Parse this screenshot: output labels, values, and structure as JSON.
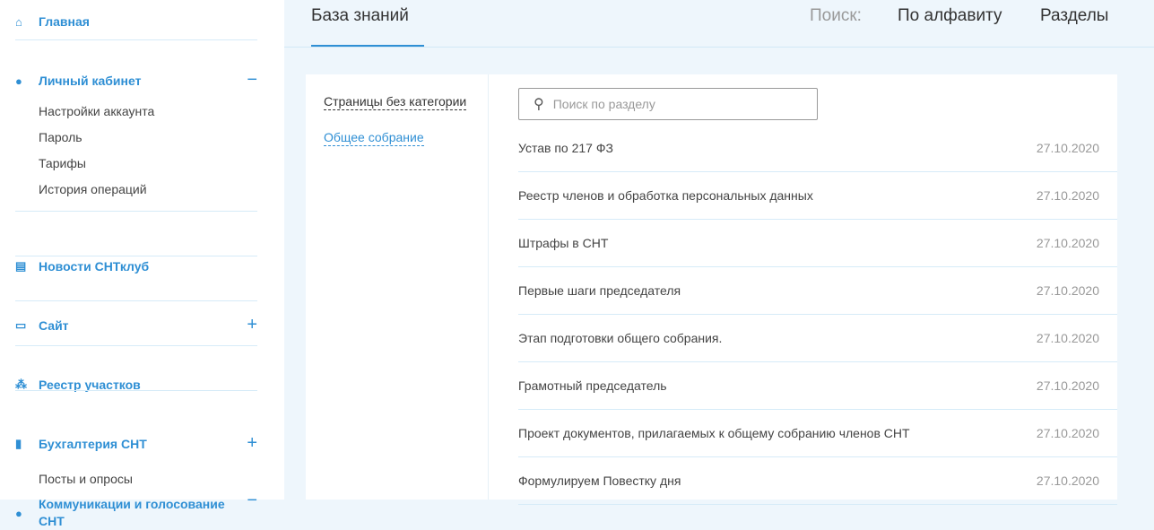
{
  "sidebar": {
    "home": "Главная",
    "account": "Личный кабинет",
    "account_items": [
      "Настройки аккаунта",
      "Пароль",
      "Тарифы",
      "История операций"
    ],
    "news": "Новости СНТклуб",
    "site": "Сайт",
    "registry": "Реестр участков",
    "accounting": "Бухгалтерия СНТ",
    "comm": "Коммуникации и голосование СНТ",
    "comm_items": [
      "Посты и опросы"
    ],
    "expand": "+",
    "collapse": "−"
  },
  "header": {
    "title": "База знаний",
    "search_label": "Поиск:",
    "alphabet": "По алфавиту",
    "sections": "Разделы"
  },
  "categories": [
    "Страницы без категории",
    "Общее собрание"
  ],
  "search": {
    "placeholder": "Поиск по разделу"
  },
  "articles": [
    {
      "title": "Устав по 217 ФЗ",
      "date": "27.10.2020"
    },
    {
      "title": "Реестр членов и обработка персональных данных",
      "date": "27.10.2020"
    },
    {
      "title": "Штрафы в СНТ",
      "date": "27.10.2020"
    },
    {
      "title": "Первые шаги председателя",
      "date": "27.10.2020"
    },
    {
      "title": "Этап подготовки общего собрания.",
      "date": "27.10.2020"
    },
    {
      "title": "Грамотный председатель",
      "date": "27.10.2020"
    },
    {
      "title": "Проект документов, прилагаемых к общему собранию членов СНТ",
      "date": "27.10.2020"
    },
    {
      "title": "Формулируем Повестку дня",
      "date": "27.10.2020"
    }
  ]
}
